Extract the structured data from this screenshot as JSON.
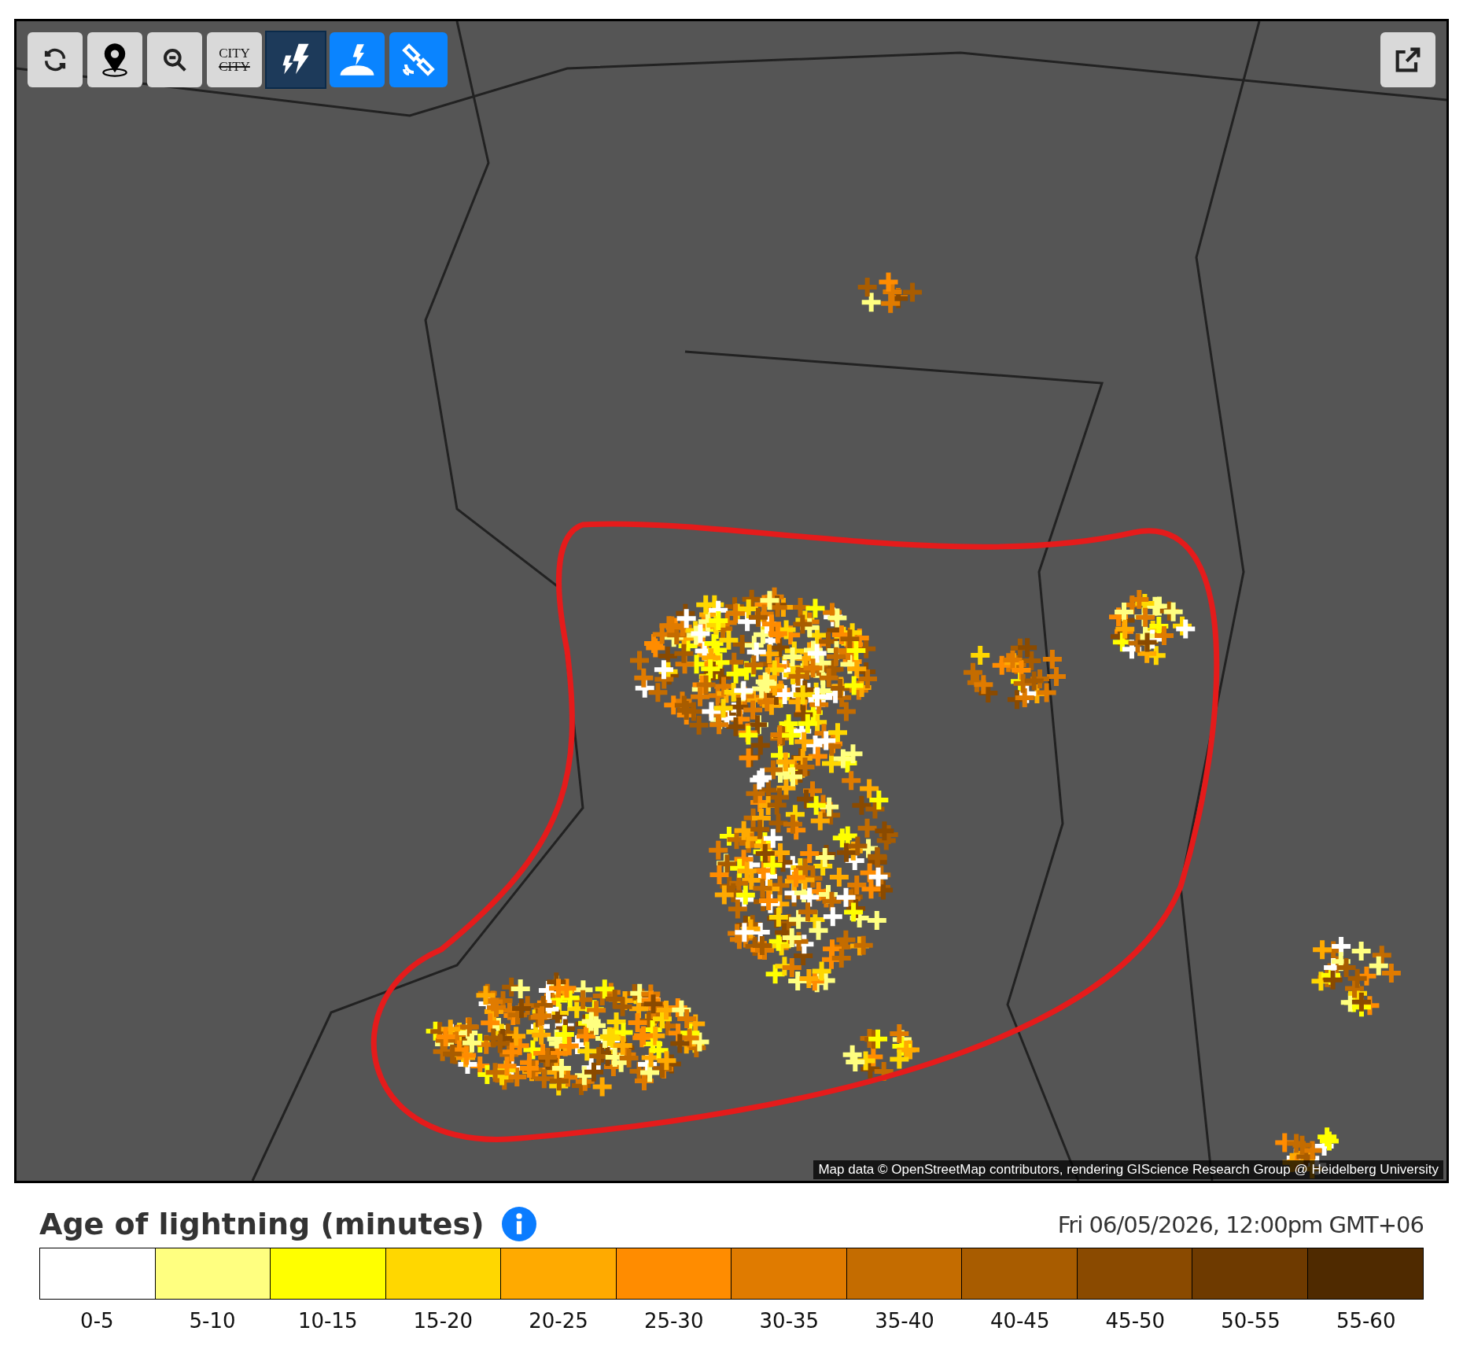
{
  "toolbar": [
    {
      "kind": "refresh",
      "selected": false
    },
    {
      "kind": "locate",
      "selected": false
    },
    {
      "kind": "zoom-out",
      "selected": false
    },
    {
      "kind": "city",
      "label": "CITY",
      "struck_label": "CITY",
      "selected": false
    },
    {
      "kind": "strikes",
      "selected": true
    },
    {
      "kind": "ground-strike",
      "selected": false
    },
    {
      "kind": "satellite",
      "selected": false
    }
  ],
  "attribution": "Map data © OpenStreetMap contributors, rendering GIScience Research Group @ Heidelberg University",
  "legend": {
    "title": "Age of lightning (minutes)",
    "timestamp": "Fri 06/05/2026, 12:00pm GMT+06",
    "bins": [
      {
        "label": "0-5",
        "color": "#ffffff"
      },
      {
        "label": "5-10",
        "color": "#ffff80"
      },
      {
        "label": "10-15",
        "color": "#ffff00"
      },
      {
        "label": "15-20",
        "color": "#ffd700"
      },
      {
        "label": "20-25",
        "color": "#ffaa00"
      },
      {
        "label": "25-30",
        "color": "#ff8c00"
      },
      {
        "label": "30-35",
        "color": "#e07b00"
      },
      {
        "label": "35-40",
        "color": "#c46c00"
      },
      {
        "label": "40-45",
        "color": "#a85c00"
      },
      {
        "label": "45-50",
        "color": "#8a4a00"
      },
      {
        "label": "50-55",
        "color": "#6e3a00"
      },
      {
        "label": "55-60",
        "color": "#4f2a00"
      }
    ]
  }
}
